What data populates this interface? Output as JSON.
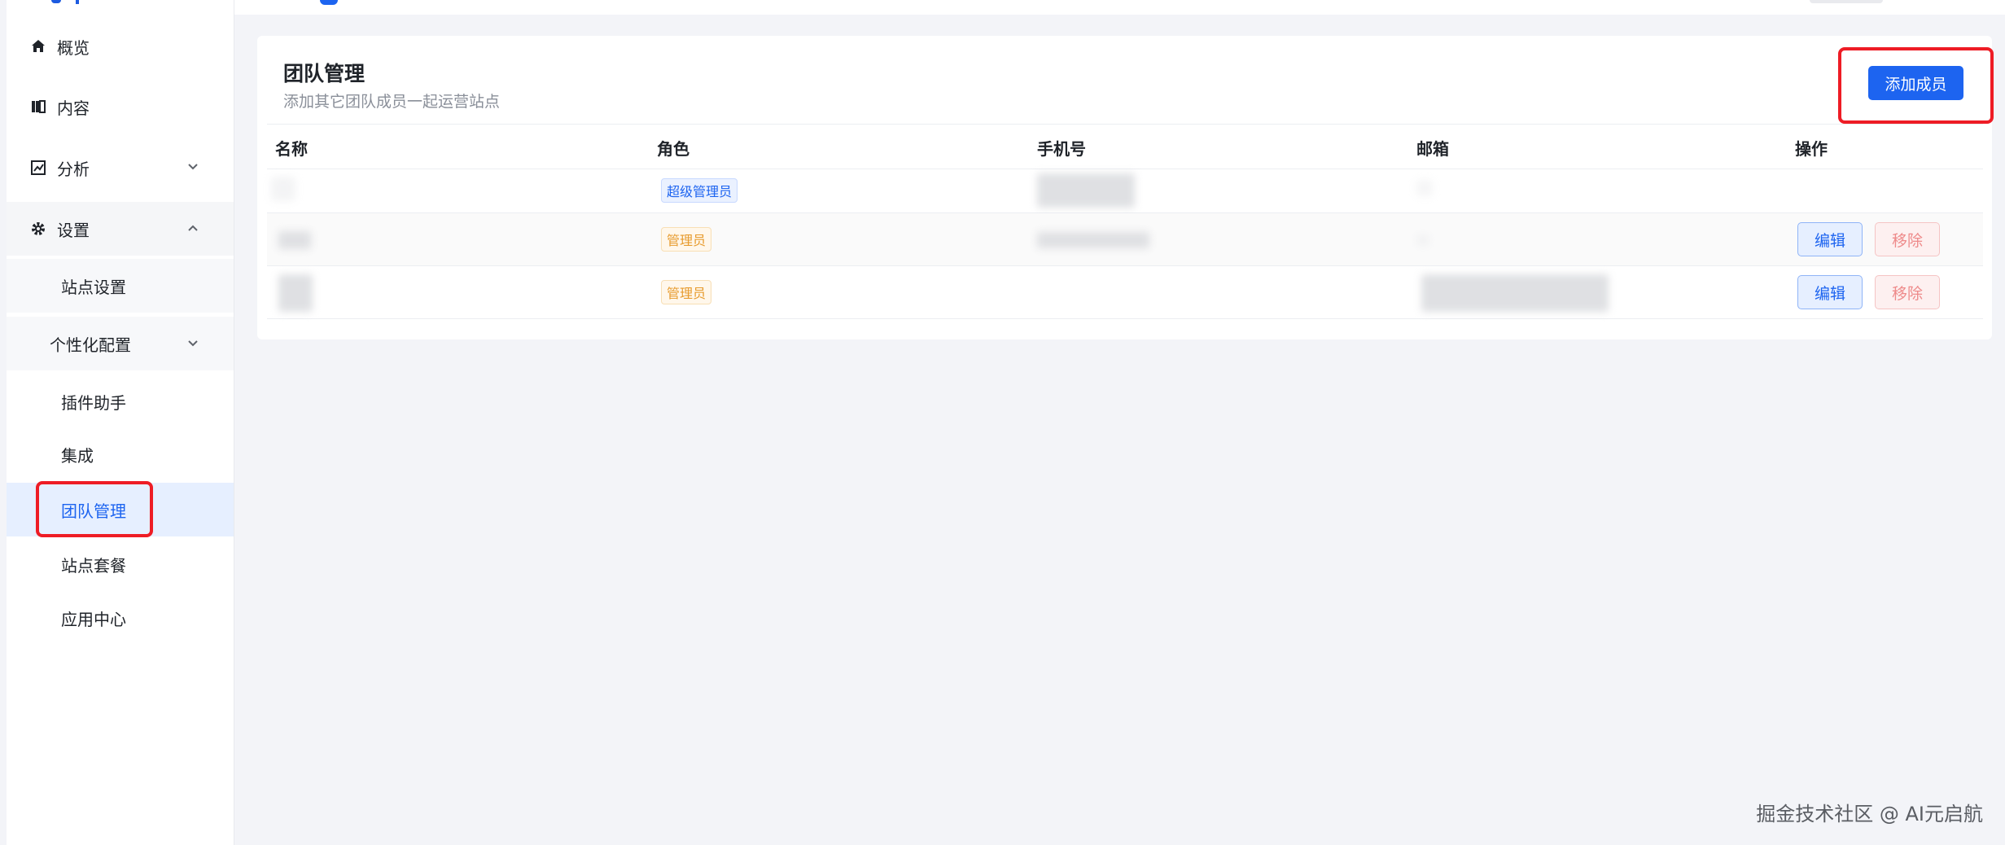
{
  "sidebar": {
    "items": [
      {
        "label": "概览",
        "icon": "home-icon"
      },
      {
        "label": "内容",
        "icon": "book-icon"
      },
      {
        "label": "分析",
        "icon": "chart-icon"
      },
      {
        "label": "设置",
        "icon": "gear-icon"
      }
    ],
    "sub_items": {
      "site_settings": "站点设置",
      "personalization": "个性化配置",
      "plugin_helper": "插件助手",
      "integration": "集成",
      "team_management": "团队管理",
      "site_plan": "站点套餐",
      "app_center": "应用中心"
    }
  },
  "main": {
    "title": "团队管理",
    "subtitle": "添加其它团队成员一起运营站点",
    "add_button": "添加成员",
    "table": {
      "headers": [
        "名称",
        "角色",
        "手机号",
        "邮箱",
        "操作"
      ],
      "rows": [
        {
          "role": "超级管理员",
          "actions": []
        },
        {
          "role": "管理员",
          "actions": [
            "编辑",
            "移除"
          ]
        },
        {
          "role": "管理员",
          "actions": [
            "编辑",
            "移除"
          ]
        }
      ]
    }
  },
  "watermark": "掘金技术社区 @ AI元启航",
  "colors": {
    "accent": "#1d64f0",
    "highlight": "#ee1c25",
    "admin_tag": "#e79b2d",
    "danger": "#ee8a8a"
  }
}
